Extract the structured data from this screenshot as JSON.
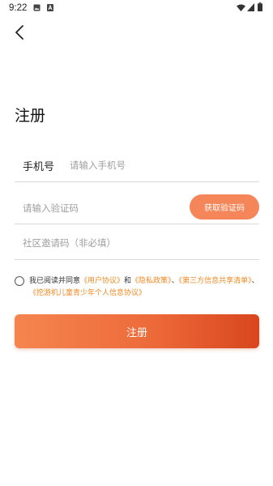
{
  "status_bar": {
    "time": "9:22",
    "icons": [
      "image-icon",
      "a-icon",
      "wifi-icon",
      "signal-icon",
      "battery-icon"
    ]
  },
  "nav": {
    "back_icon": "chevron-left-icon"
  },
  "title": "注册",
  "form": {
    "phone_label": "手机号",
    "phone_placeholder": "请输入手机号",
    "phone_value": "",
    "code_placeholder": "请输入验证码",
    "code_value": "",
    "get_code_label": "获取验证码",
    "invite_placeholder": "社区邀请码（非必填）",
    "invite_value": ""
  },
  "agreement": {
    "checked": false,
    "prefix": "我已阅读并同意",
    "user_agreement": "《用户协议》",
    "and": "和",
    "privacy_policy": "《隐私政策》",
    "separator1": "、",
    "third_party_list": "《第三方信息共享清单》",
    "separator2": "、",
    "children_protocol": "《挖游机儿童青少年个人信息协议》"
  },
  "register_label": "注册",
  "colors": {
    "accent": "#f5865a",
    "link": "#f08a24",
    "button_gradient_start": "#f5854e",
    "button_gradient_end": "#d9461e"
  }
}
